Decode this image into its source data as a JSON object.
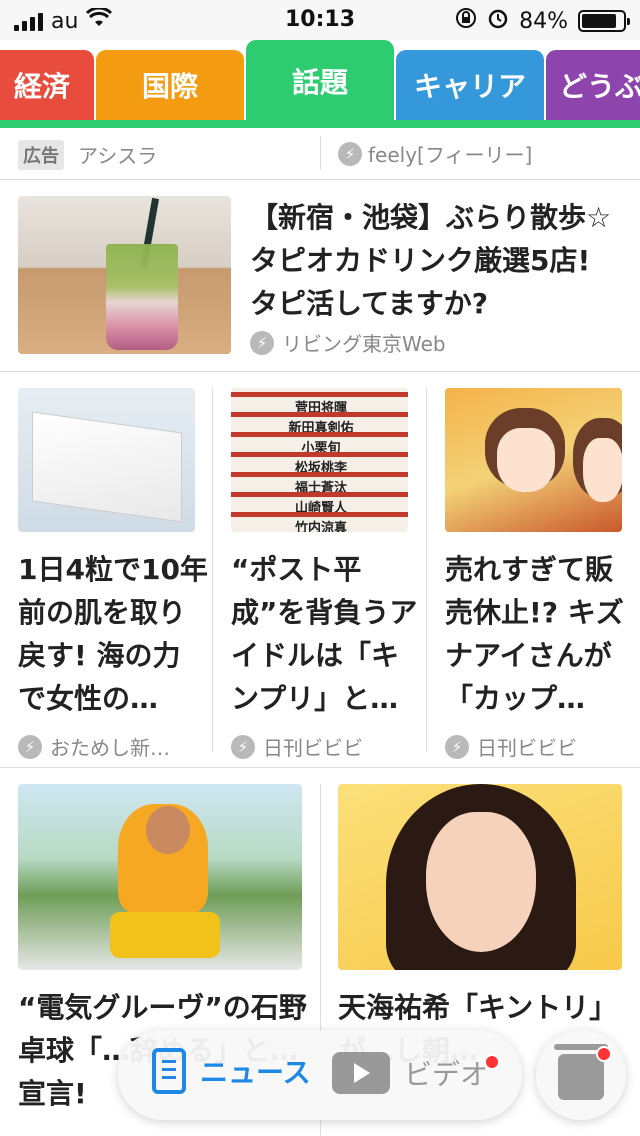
{
  "status_bar": {
    "carrier": "au",
    "time": "10:13",
    "battery_percent": "84%",
    "battery_level": 0.84
  },
  "tabs": [
    {
      "label": "経済",
      "color": "#e74c3c"
    },
    {
      "label": "国際",
      "color": "#f39c12"
    },
    {
      "label": "話題",
      "color": "#2ecc71",
      "active": true
    },
    {
      "label": "キャリア",
      "color": "#3498db"
    },
    {
      "label": "どうぶ",
      "color": "#8e44ad"
    }
  ],
  "tab_rule_color": "#2ecc71",
  "ad_row": {
    "badge": "広告",
    "advertiser": "アシスラ",
    "source": "feely[フィーリー]"
  },
  "featured": {
    "title": "【新宿・池袋】ぶらり散歩☆タピオカドリンク厳選5店! タピ活してますか?",
    "source": "リビング東京Web"
  },
  "grid3": [
    {
      "title": "1日4粒で10年前の肌を取り戻す! 海の力で女性の…",
      "source": "おためし新…"
    },
    {
      "title": "“ポスト平成”を背負うアイドルは「キンプリ」と…",
      "source": "日刊ビビビ"
    },
    {
      "title": "売れすぎて販売休止!? キズナアイさんが「カップ…",
      "source": "日刊ビビビ"
    }
  ],
  "list_image_names": [
    "菅田将暉",
    "新田真剣佑",
    "小栗旬",
    "松坂桃李",
    "福士蒼汰",
    "山崎賢人",
    "竹内涼真"
  ],
  "grid2": [
    {
      "title": "“電気グルーヴ”の石野卓球「…辞める」と…宣言!"
    },
    {
      "title": "天海祐希「キントリ」が…し朝…"
    }
  ],
  "bottom_nav": {
    "news_label": "ニュース",
    "video_label": "ビデオ"
  }
}
